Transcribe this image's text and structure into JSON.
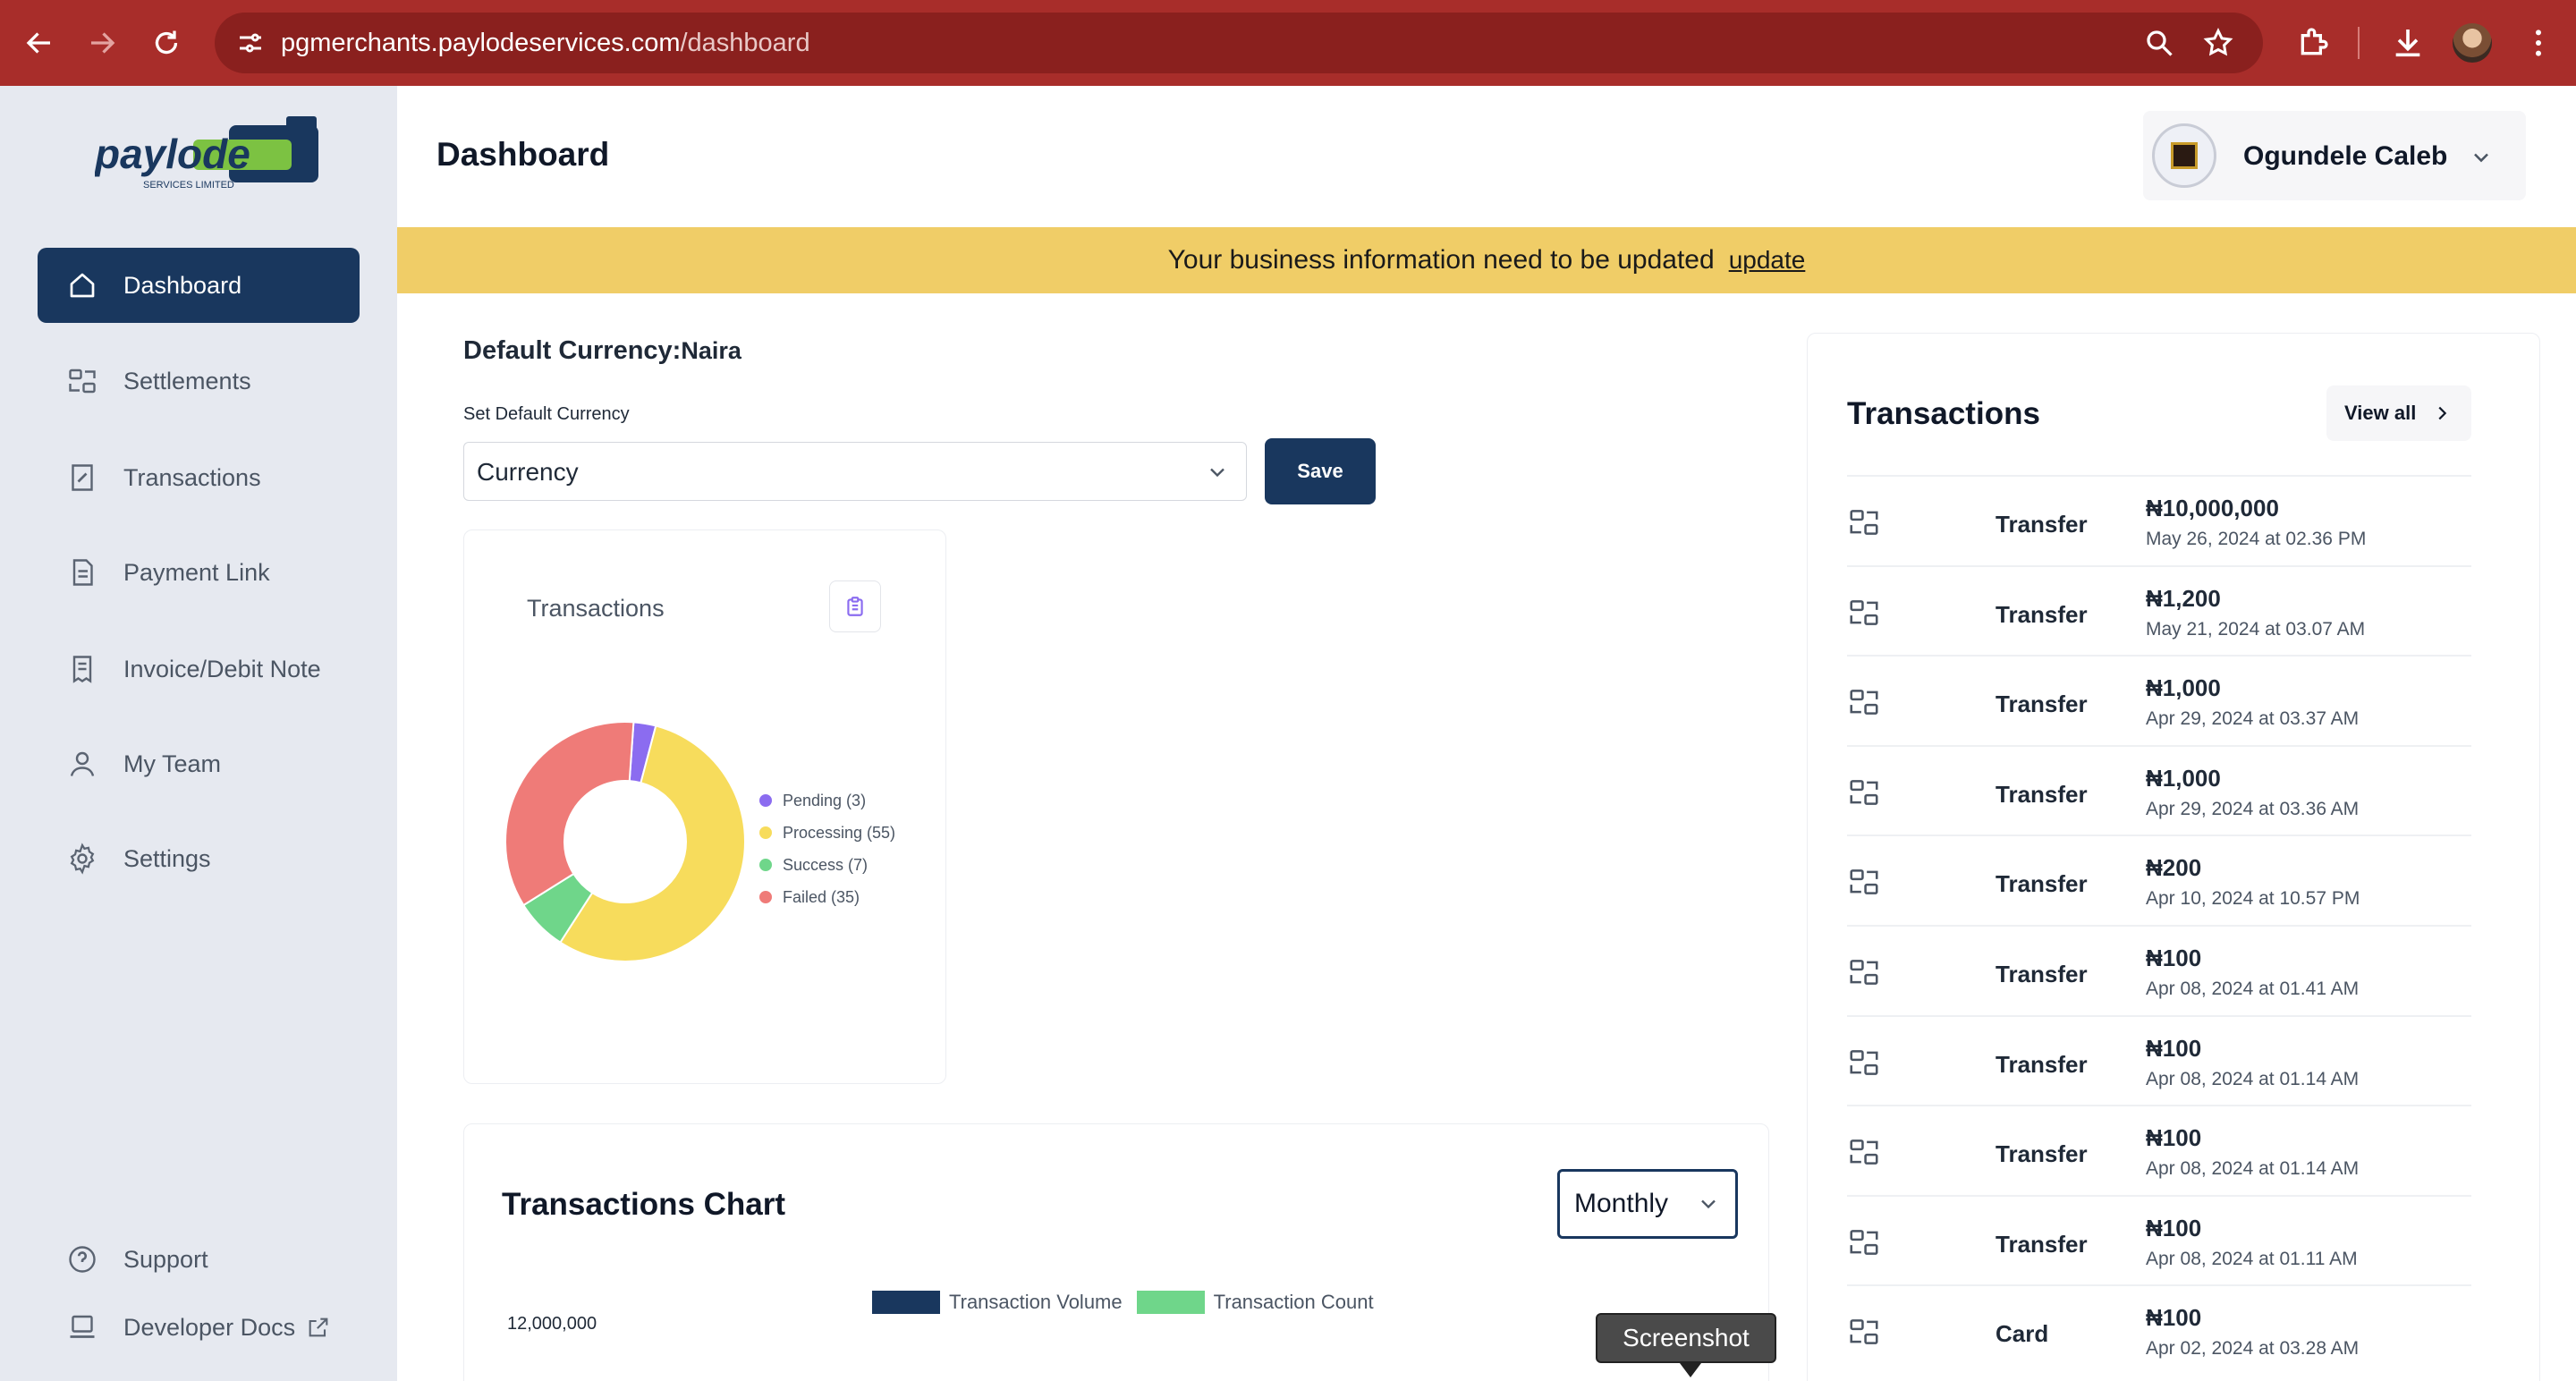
{
  "browser": {
    "url_host": "pgmerchants.paylodeservices.com",
    "url_path": "/dashboard",
    "icons": [
      "back-icon",
      "forward-icon",
      "reload-icon",
      "site-settings-icon",
      "zoom-icon",
      "bookmark-star-icon",
      "extensions-icon",
      "download-icon",
      "profile-avatar",
      "menu-icon"
    ]
  },
  "sidebar": {
    "logo_text": "paylode",
    "logo_subtext": "SERVICES LIMITED",
    "items": [
      {
        "label": "Dashboard",
        "icon": "home-icon",
        "active": true
      },
      {
        "label": "Settlements",
        "icon": "settlements-icon",
        "active": false
      },
      {
        "label": "Transactions",
        "icon": "transactions-icon",
        "active": false
      },
      {
        "label": "Payment Link",
        "icon": "document-icon",
        "active": false
      },
      {
        "label": "Invoice/Debit Note",
        "icon": "invoice-icon",
        "active": false
      },
      {
        "label": "My Team",
        "icon": "user-icon",
        "active": false
      },
      {
        "label": "Settings",
        "icon": "gear-icon",
        "active": false
      }
    ],
    "footer": [
      {
        "label": "Support",
        "icon": "help-icon"
      },
      {
        "label": "Developer Docs",
        "icon": "laptop-icon"
      }
    ]
  },
  "header": {
    "title": "Dashboard",
    "user_name": "Ogundele Caleb"
  },
  "banner": {
    "text": "Your business information need to be updated",
    "link": "update",
    "color": "#f0cd67"
  },
  "currency": {
    "title": "Default Currency:",
    "value": "Naira",
    "set_label": "Set Default Currency",
    "select_value": "Currency",
    "save_label": "Save"
  },
  "donut": {
    "title": "Transactions",
    "legend": [
      {
        "label": "Pending (3)",
        "color": "#8b6cf0"
      },
      {
        "label": "Processing (55)",
        "color": "#f7dc5c"
      },
      {
        "label": "Success (7)",
        "color": "#6fd68a"
      },
      {
        "label": "Failed (35)",
        "color": "#ef7b78"
      }
    ]
  },
  "chart_data": {
    "type": "pie",
    "labels": [
      "Pending",
      "Processing",
      "Success",
      "Failed"
    ],
    "values": [
      3,
      55,
      7,
      35
    ],
    "colors": [
      "#8b6cf0",
      "#f7dc5c",
      "#6fd68a",
      "#ef7b78"
    ],
    "title": "Transactions"
  },
  "tx_chart": {
    "title": "Transactions Chart",
    "period": "Monthly",
    "legend": [
      {
        "label": "Transaction Volume",
        "color": "#19375e"
      },
      {
        "label": "Transaction Count",
        "color": "#6fd68a"
      }
    ],
    "y_tick": "12,000,000"
  },
  "transactions": {
    "title": "Transactions",
    "view_all": "View all",
    "rows": [
      {
        "type": "Transfer",
        "amount": "₦10,000,000",
        "date": "May 26, 2024 at 02.36 PM"
      },
      {
        "type": "Transfer",
        "amount": "₦1,200",
        "date": "May 21, 2024 at 03.07 AM"
      },
      {
        "type": "Transfer",
        "amount": "₦1,000",
        "date": "Apr 29, 2024 at 03.37 AM"
      },
      {
        "type": "Transfer",
        "amount": "₦1,000",
        "date": "Apr 29, 2024 at 03.36 AM"
      },
      {
        "type": "Transfer",
        "amount": "₦200",
        "date": "Apr 10, 2024 at 10.57 PM"
      },
      {
        "type": "Transfer",
        "amount": "₦100",
        "date": "Apr 08, 2024 at 01.41 AM"
      },
      {
        "type": "Transfer",
        "amount": "₦100",
        "date": "Apr 08, 2024 at 01.14 AM"
      },
      {
        "type": "Transfer",
        "amount": "₦100",
        "date": "Apr 08, 2024 at 01.14 AM"
      },
      {
        "type": "Transfer",
        "amount": "₦100",
        "date": "Apr 08, 2024 at 01.11 AM"
      },
      {
        "type": "Card",
        "amount": "₦100",
        "date": "Apr 02, 2024 at 03.28 AM"
      }
    ]
  },
  "tooltip": {
    "text": "Screenshot"
  },
  "colors": {
    "brand": "#19375e",
    "chrome": "#a82d2a",
    "sidebar": "#e6e9f0"
  }
}
